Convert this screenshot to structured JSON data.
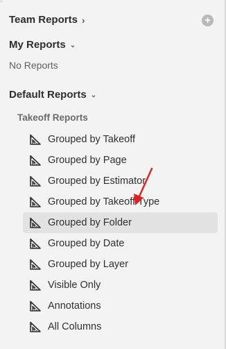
{
  "team_reports": {
    "label": "Team Reports",
    "add_icon": "plus-circle-icon",
    "add_symbol": "+"
  },
  "my_reports": {
    "label": "My Reports",
    "empty_text": "No Reports"
  },
  "default_reports": {
    "label": "Default Reports",
    "group_label": "Takeoff Reports",
    "selected_index": 4,
    "items": [
      {
        "label": "Grouped by Takeoff",
        "icon": "ruler-triangle-icon"
      },
      {
        "label": "Grouped by Page",
        "icon": "ruler-triangle-icon"
      },
      {
        "label": "Grouped by Estimator",
        "icon": "ruler-triangle-icon"
      },
      {
        "label": "Grouped by Takeoff Type",
        "icon": "ruler-triangle-icon"
      },
      {
        "label": "Grouped by Folder",
        "icon": "ruler-triangle-icon"
      },
      {
        "label": "Grouped by Date",
        "icon": "ruler-triangle-icon"
      },
      {
        "label": "Grouped by Layer",
        "icon": "ruler-triangle-icon"
      },
      {
        "label": "Visible Only",
        "icon": "ruler-triangle-icon"
      },
      {
        "label": "Annotations",
        "icon": "ruler-triangle-icon"
      },
      {
        "label": "All Columns",
        "icon": "ruler-triangle-icon"
      }
    ]
  },
  "colors": {
    "panel_bg": "#f3f3f3",
    "selected_bg": "#e2e2e2",
    "annotation_arrow": "#e21f1f"
  }
}
